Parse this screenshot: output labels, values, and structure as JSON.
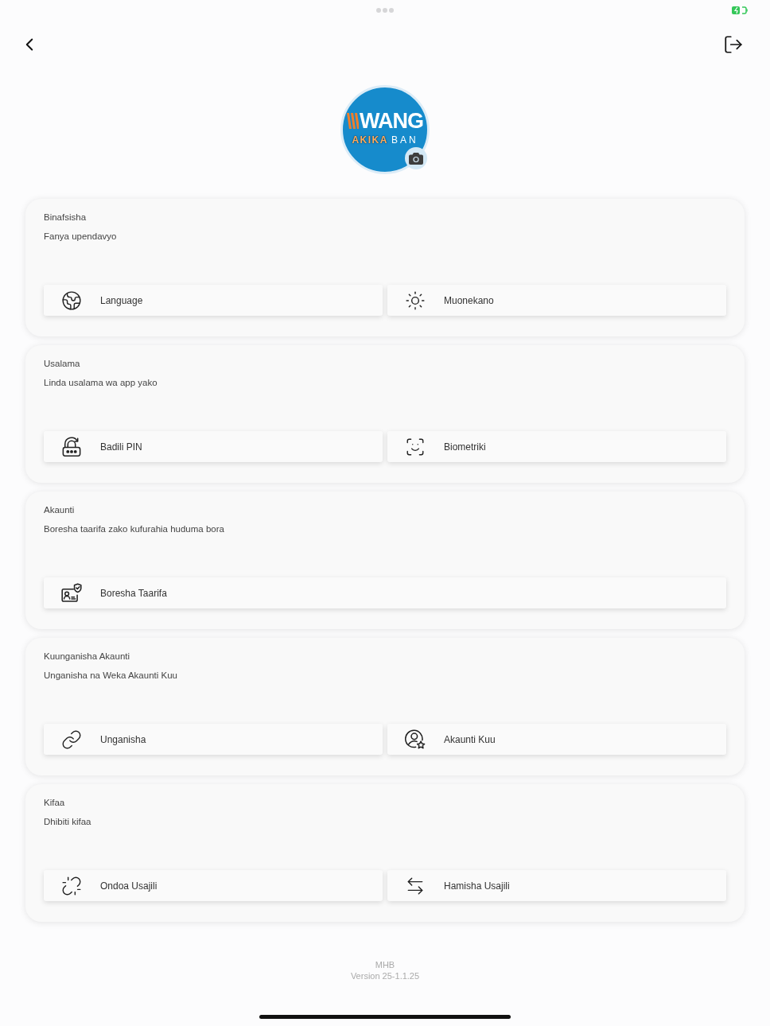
{
  "avatar": {
    "wordmark": "WANG",
    "tagline_accent": "AKIKA",
    "tagline": "BAN"
  },
  "sections": [
    {
      "title": "Binafsisha",
      "subtitle": "Fanya upendavyo",
      "actions": [
        {
          "kind": "language",
          "label": "Language"
        },
        {
          "kind": "appearance",
          "label": "Muonekano"
        }
      ]
    },
    {
      "title": "Usalama",
      "subtitle": "Linda usalama wa app yako",
      "actions": [
        {
          "kind": "pin",
          "label": "Badili PIN"
        },
        {
          "kind": "biometric",
          "label": "Biometriki"
        }
      ]
    },
    {
      "title": "Akaunti",
      "subtitle": "Boresha taarifa zako kufurahia huduma bora",
      "actions": [
        {
          "kind": "profile",
          "label": "Boresha Taarifa"
        }
      ]
    },
    {
      "title": "Kuunganisha Akaunti",
      "subtitle": "Unganisha na Weka Akaunti Kuu",
      "actions": [
        {
          "kind": "link",
          "label": "Unganisha"
        },
        {
          "kind": "primary_account",
          "label": "Akaunti Kuu"
        }
      ]
    },
    {
      "title": "Kifaa",
      "subtitle": "Dhibiti kifaa",
      "actions": [
        {
          "kind": "deregister",
          "label": "Ondoa Usajili"
        },
        {
          "kind": "transfer",
          "label": "Hamisha Usajili"
        }
      ]
    }
  ],
  "footer": {
    "app_name": "MHB",
    "version": "Version 25-1.1.25"
  }
}
